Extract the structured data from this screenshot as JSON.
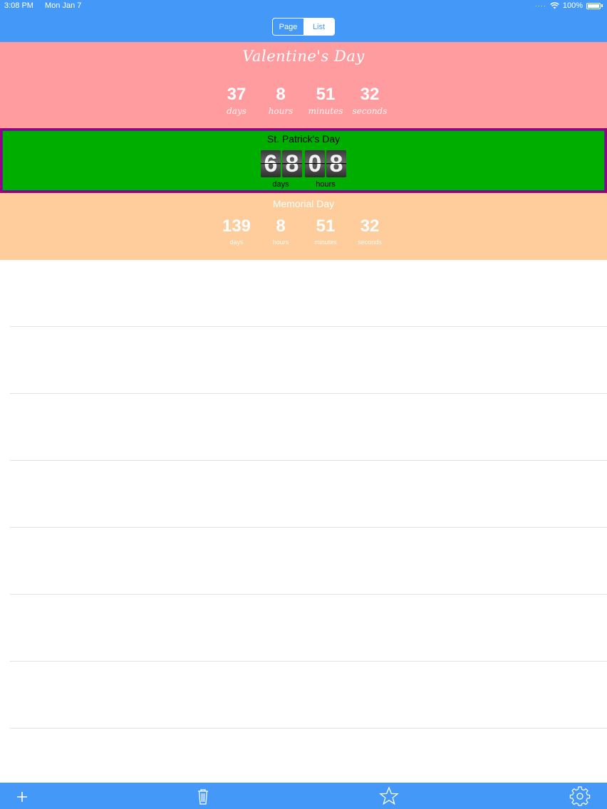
{
  "status_bar": {
    "time": "3:08 PM",
    "date": "Mon Jan 7",
    "battery": "100%"
  },
  "segmented": {
    "page_label": "Page",
    "list_label": "List",
    "selected": "Page"
  },
  "events": [
    {
      "name": "Valentine's Day",
      "background": "#ff9c9f",
      "values": [
        "37",
        "8",
        "51",
        "32"
      ],
      "labels": [
        "days",
        "hours",
        "minutes",
        "seconds"
      ]
    },
    {
      "name": "St. Patrick's Day",
      "background": "#00ae00",
      "selected": true,
      "flip_days": [
        "6",
        "8"
      ],
      "flip_hours": [
        "0",
        "8"
      ],
      "labels": [
        "days",
        "hours"
      ]
    },
    {
      "name": "Memorial Day",
      "background": "#ffcc9b",
      "values": [
        "139",
        "8",
        "51",
        "32"
      ],
      "labels": [
        "days",
        "hours",
        "minutes",
        "seconds"
      ]
    }
  ],
  "toolbar": {
    "icons": [
      "plus-icon",
      "trash-icon",
      "star-icon",
      "gear-icon"
    ],
    "accent": "#4499f8"
  }
}
